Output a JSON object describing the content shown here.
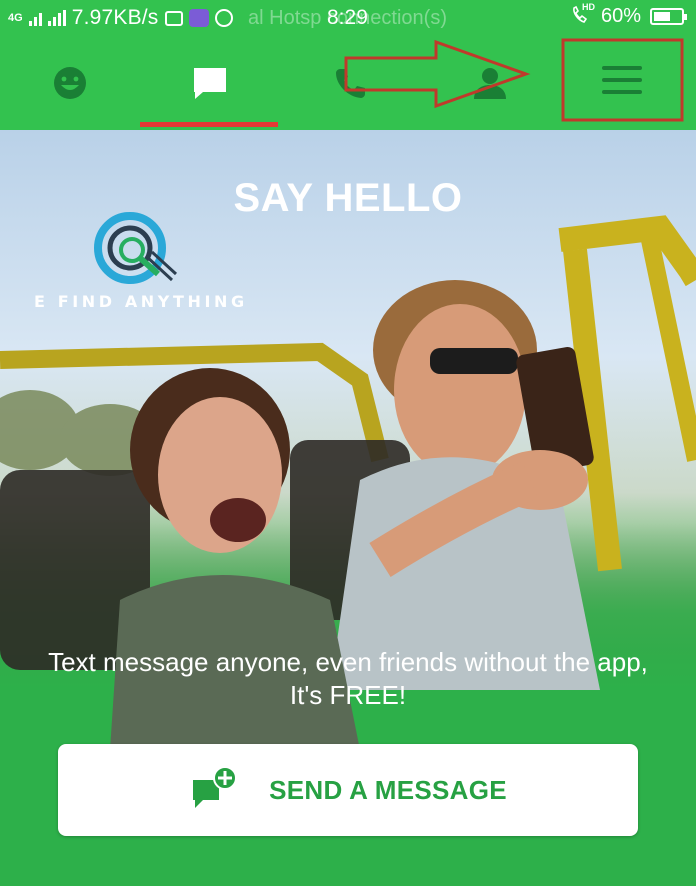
{
  "status_bar": {
    "network_type": "4G",
    "network_speed": "7.97KB/s",
    "notification_text": "al Hotsp     connection(s)",
    "time": "8:29",
    "volte_badge": "HD",
    "battery_percent": "60%",
    "battery_level": 0.6
  },
  "toolbar": {
    "tabs": [
      {
        "name": "emoji",
        "icon": "smiley-icon",
        "selected": false
      },
      {
        "name": "chat",
        "icon": "chat-bubble-icon",
        "selected": true
      },
      {
        "name": "calls",
        "icon": "phone-icon",
        "selected": false
      },
      {
        "name": "contacts",
        "icon": "contact-icon",
        "selected": false
      }
    ],
    "menu_icon": "hamburger-menu-icon"
  },
  "hero": {
    "title": "SAY HELLO",
    "watermark_text": "E FIND ANYTHING",
    "caption": "Text message anyone, even friends without the app, It's FREE!",
    "send_button_label": "SEND A MESSAGE",
    "send_button_icon": "new-message-icon"
  },
  "colors": {
    "brand_green": "#33c24f",
    "selected_underline": "#e53935",
    "annotation_red": "#c0392b",
    "button_text": "#27a143"
  }
}
